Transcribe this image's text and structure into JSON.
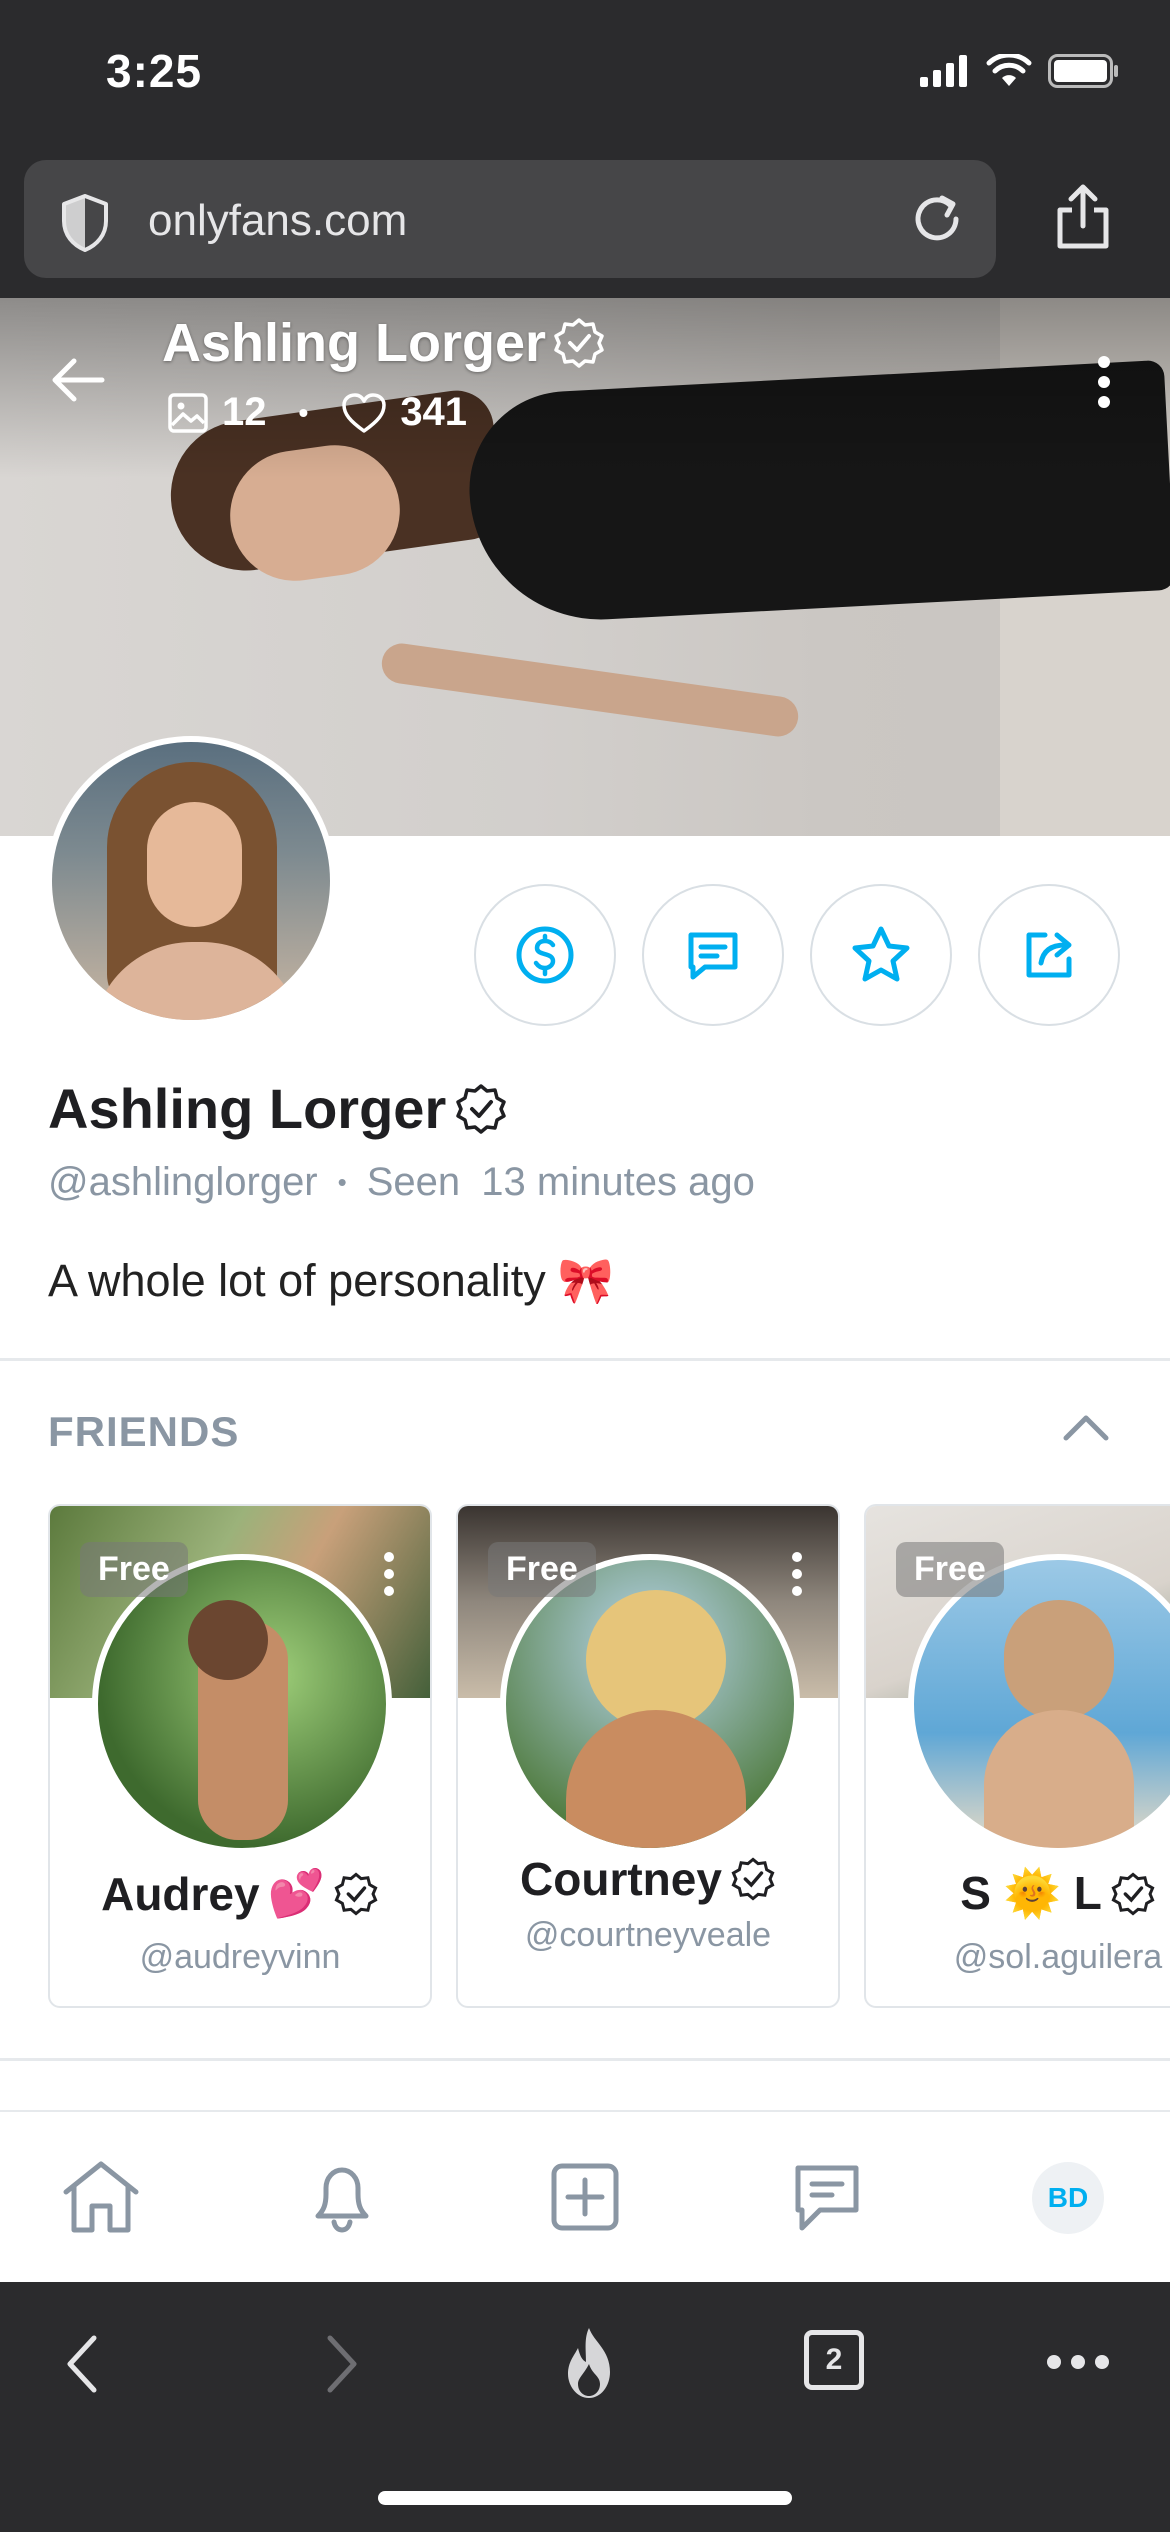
{
  "status_bar": {
    "time": "3:25"
  },
  "browser": {
    "url": "onlyfans.com",
    "tab_count": "2"
  },
  "cover": {
    "name": "Ashling Lorger",
    "photos_count": "12",
    "likes_count": "341",
    "separator": "•"
  },
  "profile": {
    "name": "Ashling Lorger",
    "handle": "@ashlinglorger",
    "dot": "•",
    "seen_label": "Seen",
    "last_seen": "13 minutes ago",
    "bio": "A whole lot of personality",
    "bio_emoji": "🎀"
  },
  "friends": {
    "title": "FRIENDS",
    "items": [
      {
        "badge": "Free",
        "name": "Audrey",
        "name_emoji": "💕",
        "handle": "@audreyvinn"
      },
      {
        "badge": "Free",
        "name": "Courtney",
        "name_emoji": "",
        "handle": "@courtneyveale"
      },
      {
        "badge": "Free",
        "name": "S 🌞 L",
        "name_emoji": "",
        "handle": "@sol.aguilera"
      }
    ]
  },
  "app_nav": {
    "user_initials": "BD"
  },
  "colors": {
    "accent": "#00aff0",
    "muted": "#8a96a3",
    "icon": "#8a96a3",
    "chrome": "#2b2b2d"
  },
  "icons": {
    "tip": "dollar-circle-icon",
    "message": "message-icon",
    "favorite": "star-icon",
    "share": "share-icon"
  }
}
